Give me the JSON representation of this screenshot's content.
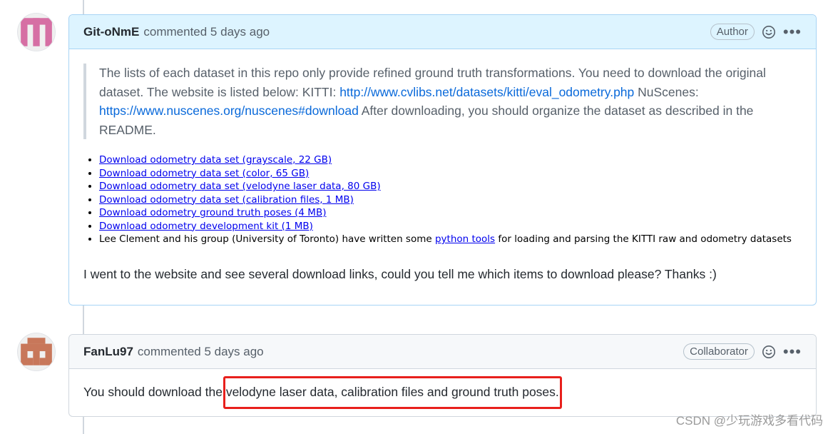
{
  "comments": [
    {
      "username": "Git-oNmE",
      "meta": "commented 5 days ago",
      "badge": "Author",
      "quote": {
        "text1": "The lists of each dataset in this repo only provide refined ground truth transformations. You need to download the original dataset. The website is listed below: KITTI: ",
        "kitti_link": "http://www.cvlibs.net/datasets/kitti/eval_odometry.php",
        "text2": " NuScenes: ",
        "nuscenes_link": "https://www.nuscenes.org/nuscenes#download",
        "text3": " After downloading, you should organize the dataset as described in the README."
      },
      "download_items": [
        "Download odometry data set (grayscale, 22 GB)",
        "Download odometry data set (color, 65 GB)",
        "Download odometry data set (velodyne laser data, 80 GB)",
        "Download odometry data set (calibration files, 1 MB)",
        "Download odometry ground truth poses (4 MB)",
        "Download odometry development kit (1 MB)"
      ],
      "last_item": {
        "before": "Lee Clement and his group (University of Toronto) have written some ",
        "link": "python tools",
        "after": " for loading and parsing the KITTI raw and odometry datasets"
      },
      "question": "I went to the website and see several download links, could you tell me which items to download please? Thanks :)"
    },
    {
      "username": "FanLu97",
      "meta": "commented 5 days ago",
      "badge": "Collaborator",
      "body_before": "You should download the ",
      "body_highlight": "velodyne laser data, calibration files and ground truth poses."
    }
  ],
  "watermark": "CSDN @少玩游戏多看代码",
  "icons": {
    "reaction": "smiley-icon",
    "more": "kebab-horizontal-icon"
  },
  "colors": {
    "link": "#0969da",
    "highlight_border": "#e8201c",
    "author_header": "#ddf4ff"
  }
}
